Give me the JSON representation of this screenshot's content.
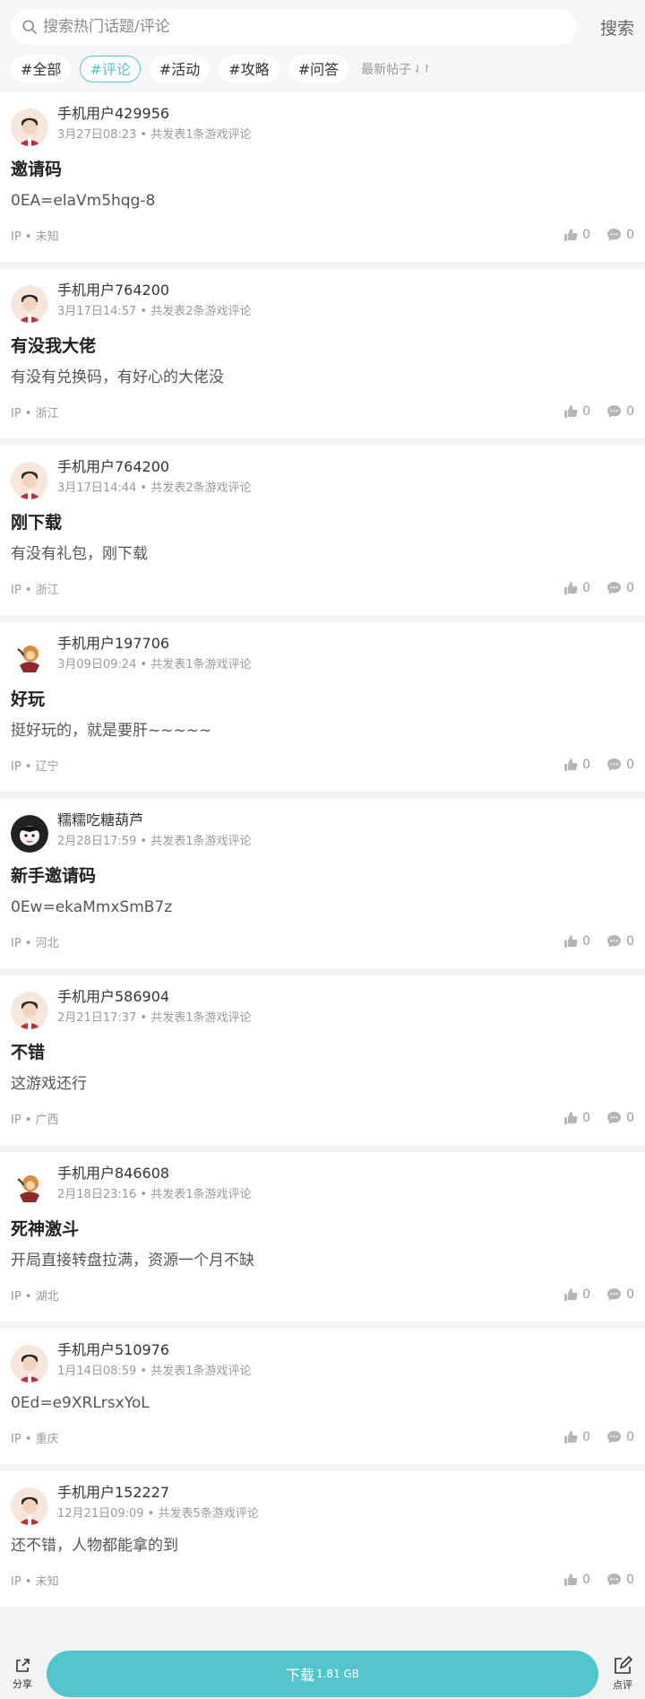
{
  "search": {
    "placeholder": "搜索热门话题/评论",
    "button_label": "搜索"
  },
  "tags": [
    {
      "label": "#全部",
      "active": false
    },
    {
      "label": "#评论",
      "active": true
    },
    {
      "label": "#活动",
      "active": false
    },
    {
      "label": "#攻略",
      "active": false
    },
    {
      "label": "#问答",
      "active": false
    }
  ],
  "sort_label": "最新帖子",
  "sort_icon": "⇃↾",
  "posts": [
    {
      "user": "手机用户429956",
      "meta": "3月27日08:23 • 共发表1条游戏评论",
      "title": "邀请码",
      "body": "0EA=elaVm5hqg-8",
      "ip": "IP • 未知",
      "likes": "0",
      "comments": "0"
    },
    {
      "user": "手机用户764200",
      "meta": "3月17日14:57 • 共发表2条游戏评论",
      "title": "有没我大佬",
      "body": "有没有兑换码，有好心的大佬没",
      "ip": "IP • 浙江",
      "likes": "0",
      "comments": "0"
    },
    {
      "user": "手机用户764200",
      "meta": "3月17日14:44 • 共发表2条游戏评论",
      "title": "刚下载",
      "body": "有没有礼包，刚下载",
      "ip": "IP • 浙江",
      "likes": "0",
      "comments": "0"
    },
    {
      "user": "手机用户197706",
      "meta": "3月09日09:24 • 共发表1条游戏评论",
      "title": "好玩",
      "body": "挺好玩的，就是要肝~~~~~",
      "ip": "IP • 辽宁",
      "likes": "0",
      "comments": "0"
    },
    {
      "user": "糯糯吃糖葫芦",
      "meta": "2月28日17:59 • 共发表1条游戏评论",
      "title": "新手邀请码",
      "body": "0Ew=ekaMmxSmB7z",
      "ip": "IP • 河北",
      "likes": "0",
      "comments": "0"
    },
    {
      "user": "手机用户586904",
      "meta": "2月21日17:37 • 共发表1条游戏评论",
      "title": "不错",
      "body": "这游戏还行",
      "ip": "IP • 广西",
      "likes": "0",
      "comments": "0"
    },
    {
      "user": "手机用户846608",
      "meta": "2月18日23:16 • 共发表1条游戏评论",
      "title": "死神激斗",
      "body": "开局直接转盘拉满，资源一个月不缺",
      "ip": "IP • 湖北",
      "likes": "0",
      "comments": "0"
    },
    {
      "user": "手机用户510976",
      "meta": "1月14日08:59 • 共发表1条游戏评论",
      "title": "",
      "body": "0Ed=e9XRLrsxYoL",
      "ip": "IP • 重庆",
      "likes": "0",
      "comments": "0"
    },
    {
      "user": "手机用户152227",
      "meta": "12月21日09:09 • 共发表5条游戏评论",
      "title": "",
      "body": "还不错，人物都能拿的到",
      "ip": "IP • 未知",
      "likes": "0",
      "comments": "0"
    }
  ],
  "bottom_bar": {
    "share_label": "分享",
    "download_label": "下载",
    "download_size": "1.81 GB",
    "review_label": "点评"
  },
  "colors": {
    "accent": "#52c5cc",
    "background": "#f2f3f5"
  },
  "icons": {
    "search": "search-icon",
    "like": "thumbs-up-icon",
    "comment": "comment-bubble-icon",
    "share": "share-icon",
    "review": "edit-icon"
  }
}
